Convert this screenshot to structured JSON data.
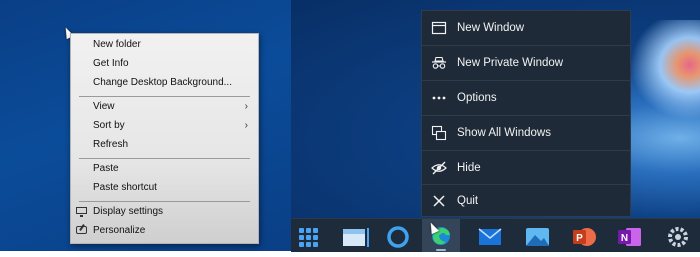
{
  "context_menu": {
    "items": [
      {
        "label": "New folder"
      },
      {
        "label": "Get Info"
      },
      {
        "label": "Change Desktop Background..."
      },
      {
        "label": "View"
      },
      {
        "label": "Sort by"
      },
      {
        "label": "Refresh"
      },
      {
        "label": "Paste"
      },
      {
        "label": "Paste shortcut"
      },
      {
        "label": "Display settings",
        "icon": "monitor-icon"
      },
      {
        "label": "Personalize",
        "icon": "personalize-icon"
      }
    ]
  },
  "jump_list": {
    "items": [
      {
        "label": "New Window",
        "icon": "window-icon"
      },
      {
        "label": "New Private Window",
        "icon": "private-window-icon"
      },
      {
        "label": "Options",
        "icon": "more-icon"
      },
      {
        "label": "Show All Windows",
        "icon": "windows-icon"
      },
      {
        "label": "Hide",
        "icon": "hide-icon"
      },
      {
        "label": "Quit",
        "icon": "close-icon"
      }
    ]
  },
  "taskbar": {
    "apps": [
      {
        "name": "Start",
        "icon": "start-grid-icon"
      },
      {
        "name": "File Explorer",
        "icon": "folder-icon"
      },
      {
        "name": "Cortana",
        "icon": "cortana-icon"
      },
      {
        "name": "Microsoft Edge",
        "icon": "edge-icon",
        "active": true
      },
      {
        "name": "Mail",
        "icon": "mail-icon"
      },
      {
        "name": "Photos",
        "icon": "photos-icon"
      },
      {
        "name": "PowerPoint",
        "icon": "powerpoint-icon"
      },
      {
        "name": "OneNote",
        "icon": "onenote-icon"
      },
      {
        "name": "Settings",
        "icon": "settings-icon"
      }
    ]
  },
  "colors": {
    "desktop": "#0b4c9a",
    "menu_dark": "#1e2a38",
    "taskbar": "#1e2b3a"
  }
}
